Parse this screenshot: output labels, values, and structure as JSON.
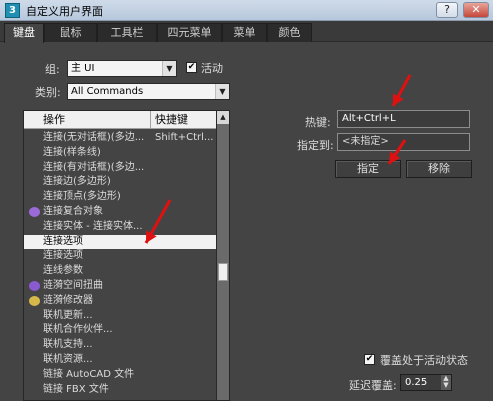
{
  "window": {
    "title": "自定义用户界面",
    "help_label": "?",
    "close_label": "✕"
  },
  "tabs": [
    {
      "label": "键盘",
      "active": true
    },
    {
      "label": "鼠标",
      "active": false
    },
    {
      "label": "工具栏",
      "active": false
    },
    {
      "label": "四元菜单",
      "active": false
    },
    {
      "label": "菜单",
      "active": false
    },
    {
      "label": "颜色",
      "active": false
    }
  ],
  "group": {
    "label": "组:",
    "value": "主 UI",
    "active_label": "活动",
    "active_checked": "✔"
  },
  "category": {
    "label": "类别:",
    "value": "All Commands"
  },
  "list": {
    "col_action": "操作",
    "col_shortcut": "快捷键",
    "rows": [
      {
        "text": "连接(无对话框)(多边...",
        "shortcut": "Shift+Ctrl...",
        "icon": ""
      },
      {
        "text": "连接(样条线)",
        "shortcut": "",
        "icon": ""
      },
      {
        "text": "连接(有对话框)(多边...",
        "shortcut": "",
        "icon": ""
      },
      {
        "text": "连接边(多边形)",
        "shortcut": "",
        "icon": ""
      },
      {
        "text": "连接顶点(多边形)",
        "shortcut": "",
        "icon": ""
      },
      {
        "text": "连接复合对象",
        "shortcut": "",
        "icon": "#9a6ad8"
      },
      {
        "text": "连接实体 - 连接实体...",
        "shortcut": "",
        "icon": ""
      },
      {
        "text": "连接选项",
        "shortcut": "",
        "icon": "",
        "selected": true
      },
      {
        "text": "连接选项",
        "shortcut": "",
        "icon": ""
      },
      {
        "text": "连线参数",
        "shortcut": "",
        "icon": ""
      },
      {
        "text": "涟漪空间扭曲",
        "shortcut": "",
        "icon": "#8a5ad0"
      },
      {
        "text": "涟漪修改器",
        "shortcut": "",
        "icon": "#d6b84a"
      },
      {
        "text": "联机更新...",
        "shortcut": "",
        "icon": ""
      },
      {
        "text": "联机合作伙伴...",
        "shortcut": "",
        "icon": ""
      },
      {
        "text": "联机支持...",
        "shortcut": "",
        "icon": ""
      },
      {
        "text": "联机资源...",
        "shortcut": "",
        "icon": ""
      },
      {
        "text": "链接 AutoCAD 文件",
        "shortcut": "",
        "icon": ""
      },
      {
        "text": "链接 FBX 文件",
        "shortcut": "",
        "icon": ""
      }
    ]
  },
  "hotkey": {
    "label": "热键:",
    "value": "Alt+Ctrl+L"
  },
  "assigned": {
    "label": "指定到:",
    "value": "<未指定>"
  },
  "buttons": {
    "assign": "指定",
    "remove": "移除"
  },
  "override": {
    "label": "覆盖处于活动状态",
    "checked": "✔"
  },
  "delay": {
    "label": "延迟覆盖:",
    "value": "0.25"
  },
  "colors": {
    "annotation_arrow": "#e01010"
  }
}
